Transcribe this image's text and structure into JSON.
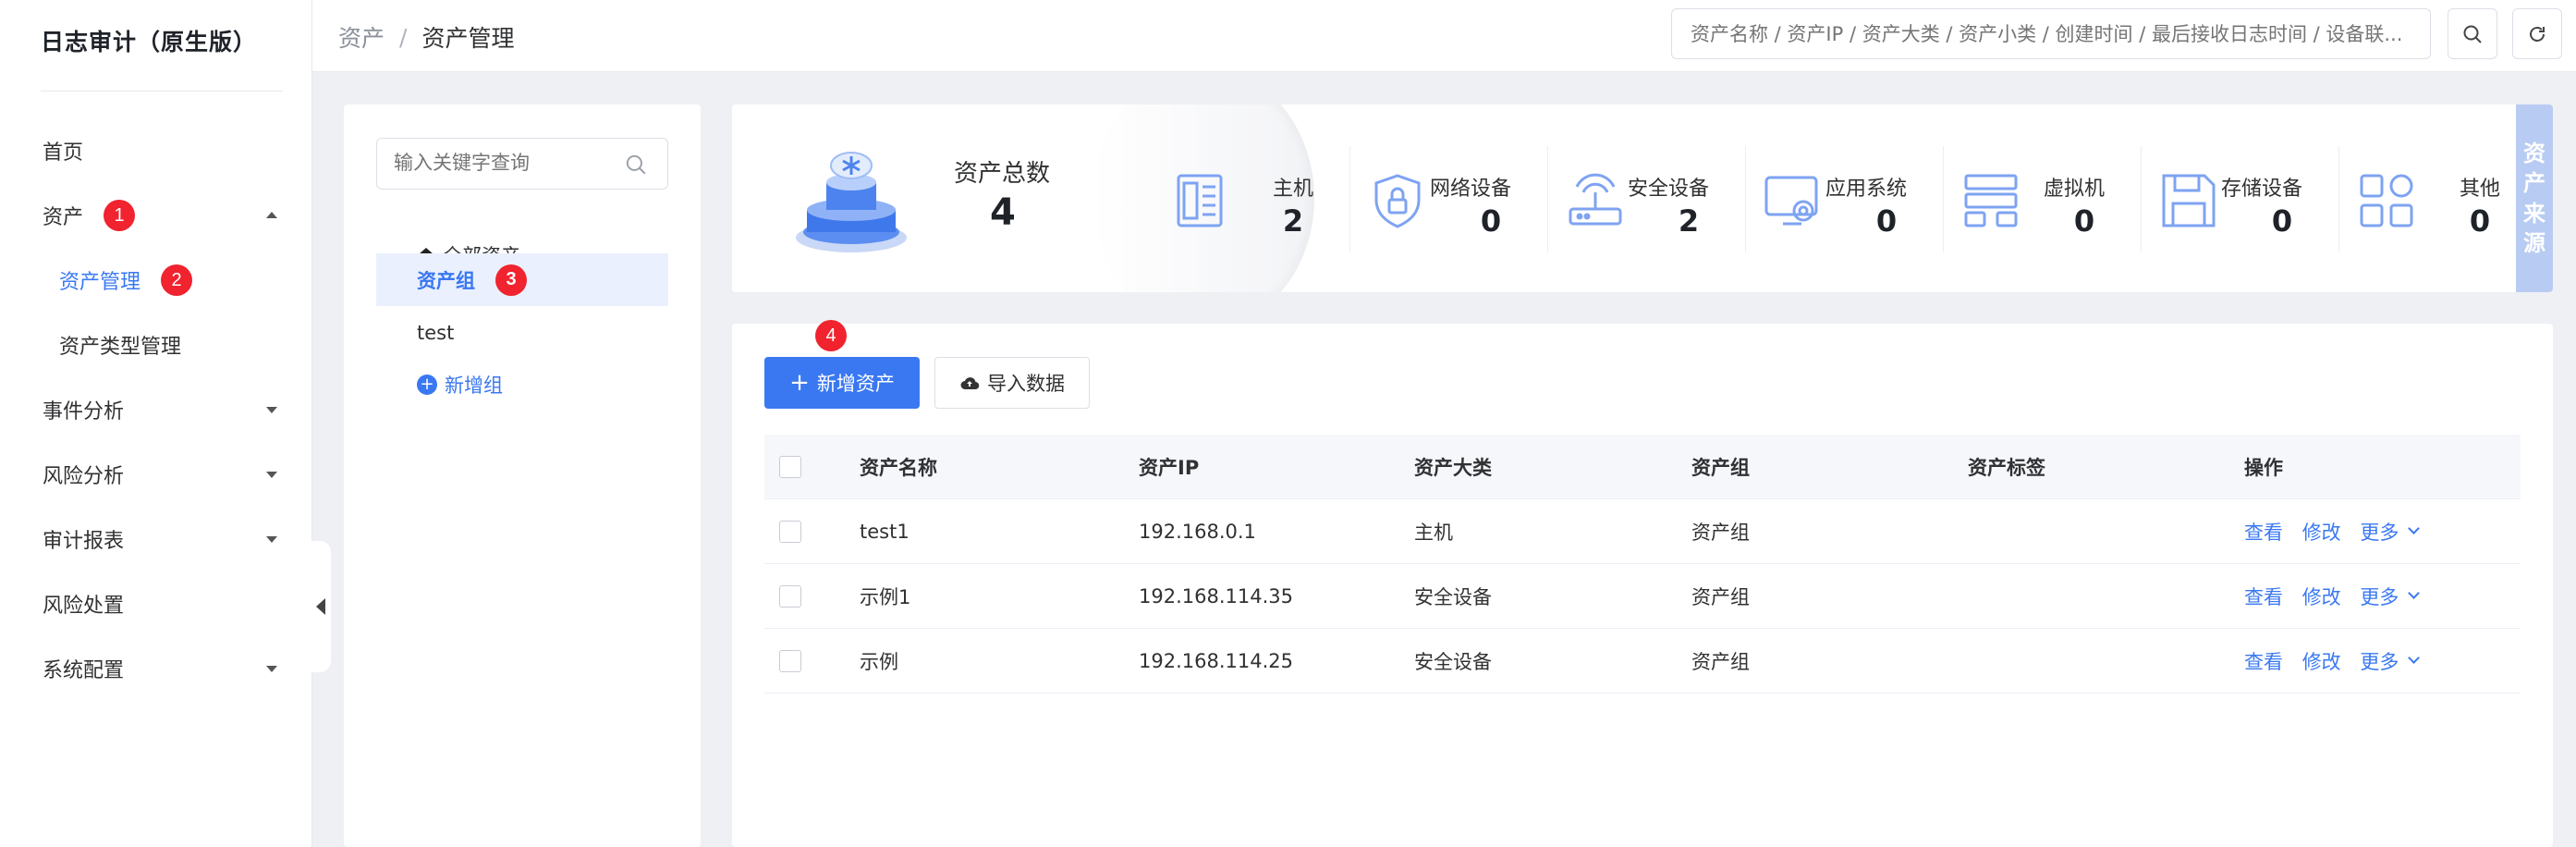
{
  "app": {
    "title": "日志审计（原生版）"
  },
  "sidebar": {
    "items": [
      {
        "label": "首页"
      },
      {
        "label": "资产",
        "badge": "1"
      },
      {
        "label": "资产管理",
        "badge": "2"
      },
      {
        "label": "资产类型管理"
      },
      {
        "label": "事件分析"
      },
      {
        "label": "风险分析"
      },
      {
        "label": "审计报表"
      },
      {
        "label": "风险处置"
      },
      {
        "label": "系统配置"
      }
    ]
  },
  "header": {
    "breadcrumb": {
      "parent": "资产",
      "separator": "/",
      "current": "资产管理"
    },
    "search_placeholder": "资产名称 / 资产IP / 资产大类 / 资产小类 / 创建时间 / 最后接收日志时间 / 设备联..."
  },
  "groups": {
    "search_placeholder": "输入关键字查询",
    "items": [
      {
        "label": "全部资产"
      },
      {
        "label": "资产组",
        "badge": "3"
      },
      {
        "label": "test"
      }
    ],
    "add_label": "新增组"
  },
  "stats": {
    "total_label": "资产总数",
    "total_value": "4",
    "items": [
      {
        "label": "主机",
        "value": "2",
        "icon": "host-icon"
      },
      {
        "label": "网络设备",
        "value": "0",
        "icon": "network-device-icon"
      },
      {
        "label": "安全设备",
        "value": "2",
        "icon": "security-device-icon"
      },
      {
        "label": "应用系统",
        "value": "0",
        "icon": "app-system-icon"
      },
      {
        "label": "虚拟机",
        "value": "0",
        "icon": "vm-icon"
      },
      {
        "label": "存储设备",
        "value": "0",
        "icon": "storage-icon"
      },
      {
        "label": "其他",
        "value": "0",
        "icon": "other-icon"
      }
    ],
    "source_tab": [
      "资",
      "产",
      "来",
      "源"
    ]
  },
  "toolbar": {
    "add_label": "新增资产",
    "add_badge": "4",
    "import_label": "导入数据"
  },
  "table": {
    "columns": [
      "资产名称",
      "资产IP",
      "资产大类",
      "资产组",
      "资产标签",
      "操作"
    ],
    "rows": [
      {
        "name": "test1",
        "ip": "192.168.0.1",
        "category": "主机",
        "group": "资产组",
        "tag": ""
      },
      {
        "name": "示例1",
        "ip": "192.168.114.35",
        "category": "安全设备",
        "group": "资产组",
        "tag": ""
      },
      {
        "name": "示例",
        "ip": "192.168.114.25",
        "category": "安全设备",
        "group": "资产组",
        "tag": ""
      }
    ],
    "actions": {
      "view": "查看",
      "edit": "修改",
      "more": "更多"
    }
  },
  "colors": {
    "primary": "#3a78f2",
    "badge": "#f0232e",
    "source_tab": "#b8cbf2"
  }
}
